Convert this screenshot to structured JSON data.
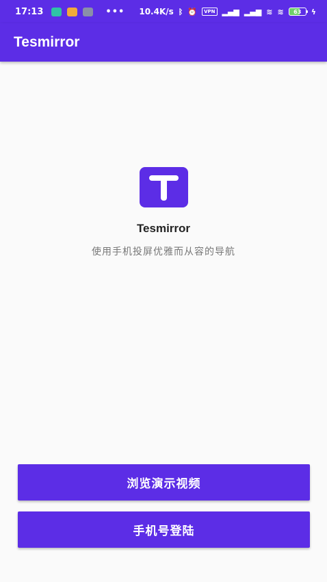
{
  "status_bar": {
    "time": "17:13",
    "net_speed": "10.4K/s",
    "vpn_label": "VPN",
    "battery_level": "63",
    "battery_color": "#6fd06a",
    "icons": [
      "message-app-icon",
      "gallery-app-icon",
      "telegram-icon",
      "bluetooth-icon",
      "alarm-icon",
      "hd-signal-icon",
      "signal-icon",
      "wifi-icon",
      "charging-icon"
    ]
  },
  "app_bar": {
    "title": "Tesmirror"
  },
  "main": {
    "app_name": "Tesmirror",
    "tagline": "使用手机投屏优雅而从容的导航"
  },
  "buttons": {
    "demo_video": "浏览演示视频",
    "phone_login": "手机号登陆"
  },
  "colors": {
    "primary": "#5c2de6",
    "background": "#fafafa"
  }
}
